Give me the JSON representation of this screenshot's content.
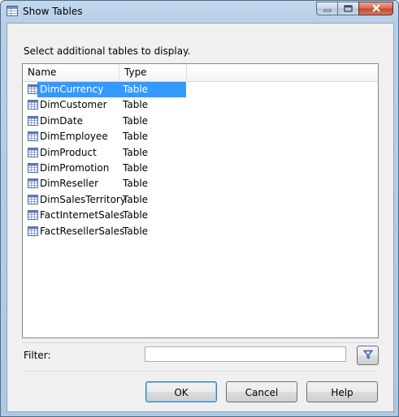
{
  "window": {
    "title": "Show Tables"
  },
  "dialog": {
    "prompt": "Select additional tables to display."
  },
  "list": {
    "columns": [
      "Name",
      "Type"
    ],
    "rows": [
      {
        "name": "DimCurrency",
        "type": "Table",
        "selected": true
      },
      {
        "name": "DimCustomer",
        "type": "Table"
      },
      {
        "name": "DimDate",
        "type": "Table"
      },
      {
        "name": "DimEmployee",
        "type": "Table"
      },
      {
        "name": "DimProduct",
        "type": "Table"
      },
      {
        "name": "DimPromotion",
        "type": "Table"
      },
      {
        "name": "DimReseller",
        "type": "Table"
      },
      {
        "name": "DimSalesTerritory",
        "type": "Table"
      },
      {
        "name": "FactInternetSales",
        "type": "Table"
      },
      {
        "name": "FactResellerSales",
        "type": "Table"
      }
    ]
  },
  "filter": {
    "label": "Filter:",
    "value": "",
    "placeholder": ""
  },
  "buttons": {
    "ok": "OK",
    "cancel": "Cancel",
    "help": "Help"
  },
  "colors": {
    "selection": "#3399ff",
    "filter_icon": "#2b5fb4"
  },
  "icons": {
    "title": "show-tables-icon",
    "row": "table-icon",
    "filter": "funnel-icon"
  }
}
